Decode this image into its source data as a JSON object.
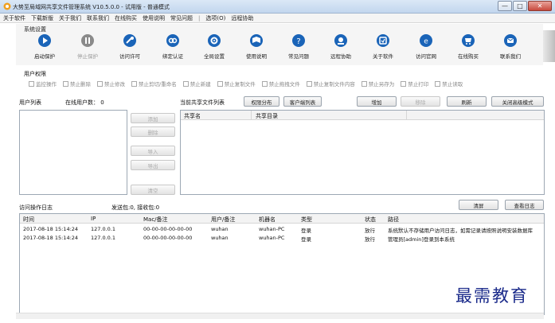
{
  "window": {
    "title": "大势至局域网共享文件管理系统 V10.5.0.0 - 试用版 - 普通模式",
    "minimize": "—",
    "maximize": "□",
    "close": "✕"
  },
  "menu": {
    "items": [
      "关于软件",
      "下载新版",
      "关于我们",
      "联系我们",
      "在线购买",
      "使用说明",
      "常见问题",
      "|",
      "选项(O)",
      "远程协助"
    ]
  },
  "system_settings": {
    "title": "系统设置",
    "tools": [
      {
        "label": "启动保护",
        "icon": "play-icon",
        "color": "#1a64b8",
        "enabled": true
      },
      {
        "label": "停止保护",
        "icon": "pause-icon",
        "color": "#8a8a8a",
        "enabled": false
      },
      {
        "label": "访问许可",
        "icon": "key-icon",
        "color": "#1a64b8",
        "enabled": true
      },
      {
        "label": "绑定认证",
        "icon": "bind-icon",
        "color": "#1a64b8",
        "enabled": true
      },
      {
        "label": "全局设置",
        "icon": "gear-icon",
        "color": "#1a64b8",
        "enabled": true
      },
      {
        "label": "使用说明",
        "icon": "book-icon",
        "color": "#1a64b8",
        "enabled": true
      },
      {
        "label": "常见问题",
        "icon": "question-icon",
        "color": "#1a64b8",
        "enabled": true
      },
      {
        "label": "远程协助",
        "icon": "remote-icon",
        "color": "#1a64b8",
        "enabled": true
      },
      {
        "label": "关于软件",
        "icon": "info-icon",
        "color": "#1a64b8",
        "enabled": true
      },
      {
        "label": "访问官网",
        "icon": "web-icon",
        "color": "#1a64b8",
        "enabled": true
      },
      {
        "label": "在线购买",
        "icon": "cart-icon",
        "color": "#1a64b8",
        "enabled": true
      },
      {
        "label": "联系我们",
        "icon": "contact-icon",
        "color": "#1a64b8",
        "enabled": true
      }
    ]
  },
  "user_permissions": {
    "title": "用户权限",
    "items": [
      "监控操作",
      "禁止删除",
      "禁止修改",
      "禁止剪切/重命名",
      "禁止新建",
      "禁止复制文件",
      "禁止拖拽文件",
      "禁止复制文件内容",
      "禁止另存为",
      "禁止打印",
      "禁止读取"
    ]
  },
  "user_list": {
    "title": "用户列表",
    "online_count": "在线用户数： 0",
    "buttons": [
      "添加",
      "删除",
      "导入",
      "导出",
      "清空"
    ]
  },
  "shared_files": {
    "title": "当前共享文件列表",
    "buttons": {
      "permission_dist": "权限分布",
      "client_list": "客户端列表",
      "add": "增加",
      "remove": "移除",
      "refresh": "刷新",
      "close_advanced": "关闭高级模式"
    },
    "columns": [
      "共享名",
      "共享目录"
    ]
  },
  "log": {
    "title": "访问操作日志",
    "stats": "发送包:0, 接收包:0",
    "clear_button": "清屏",
    "view_button": "查看日志",
    "columns": [
      "时间",
      "IP",
      "Mac/备注",
      "用户/备注",
      "机器名",
      "类型",
      "状态",
      "路径"
    ],
    "rows": [
      [
        "2017-08-18 15:14:24",
        "127.0.0.1",
        "00-00-00-00-00-00",
        "wuhan",
        "wuhan-PC",
        "登录",
        "放行",
        "系统默认不存储用户访问日志，如需记录请按照说明安装数据库"
      ],
      [
        "2017-08-18 15:14:24",
        "127.0.0.1",
        "00-00-00-00-00-00",
        "wuhan",
        "wuhan-PC",
        "登录",
        "放行",
        "管理员[admin]登录到本系统"
      ]
    ]
  },
  "watermark": "最需教育"
}
